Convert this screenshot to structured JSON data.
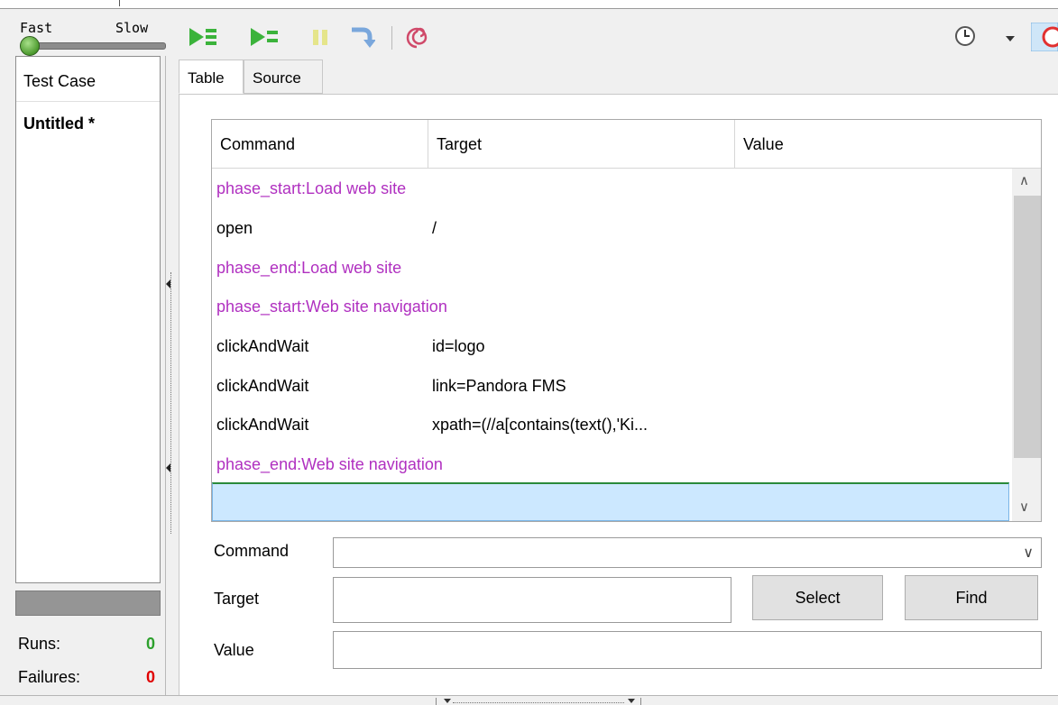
{
  "toolbar": {
    "speed_fast": "Fast",
    "speed_slow": "Slow",
    "buttons": [
      "play-suite-icon",
      "play-test-icon",
      "pause-icon",
      "step-icon",
      "rollup-icon",
      "schedule-icon",
      "dropdown-arrow-icon",
      "record-icon"
    ],
    "colors": {
      "play": "#3bb33b",
      "pause": "#e0e07a",
      "step": "#6a9fd8",
      "rollup": "#d04a6a",
      "record": "#e23030"
    }
  },
  "left_panel": {
    "header": "Test Case",
    "test_case": "Untitled *",
    "runs_label": "Runs:",
    "runs_value": "0",
    "failures_label": "Failures:",
    "failures_value": "0",
    "colors": {
      "runs": "#2ca02c",
      "failures": "#e00000"
    }
  },
  "tabs": [
    {
      "label": "Table",
      "active": true
    },
    {
      "label": "Source",
      "active": false
    }
  ],
  "table": {
    "columns": [
      "Command",
      "Target",
      "Value"
    ],
    "rows": [
      {
        "command": "phase_start:Load web site",
        "target": "",
        "value": "",
        "phase": true
      },
      {
        "command": "open",
        "target": "/",
        "value": "",
        "phase": false
      },
      {
        "command": "phase_end:Load web site",
        "target": "",
        "value": "",
        "phase": true
      },
      {
        "command": "phase_start:Web site navigation",
        "target": "",
        "value": "",
        "phase": true
      },
      {
        "command": "clickAndWait",
        "target": "id=logo",
        "value": "",
        "phase": false
      },
      {
        "command": "clickAndWait",
        "target": "link=Pandora FMS",
        "value": "",
        "phase": false
      },
      {
        "command": "clickAndWait",
        "target": "xpath=(//a[contains(text(),'Ki...",
        "value": "",
        "phase": false
      },
      {
        "command": "phase_end:Web site navigation",
        "target": "",
        "value": "",
        "phase": true
      }
    ],
    "phase_color": "#b030c0"
  },
  "form": {
    "command_label": "Command",
    "target_label": "Target",
    "value_label": "Value",
    "command_value": "",
    "target_value": "",
    "value_value": "",
    "select_button": "Select",
    "find_button": "Find"
  }
}
